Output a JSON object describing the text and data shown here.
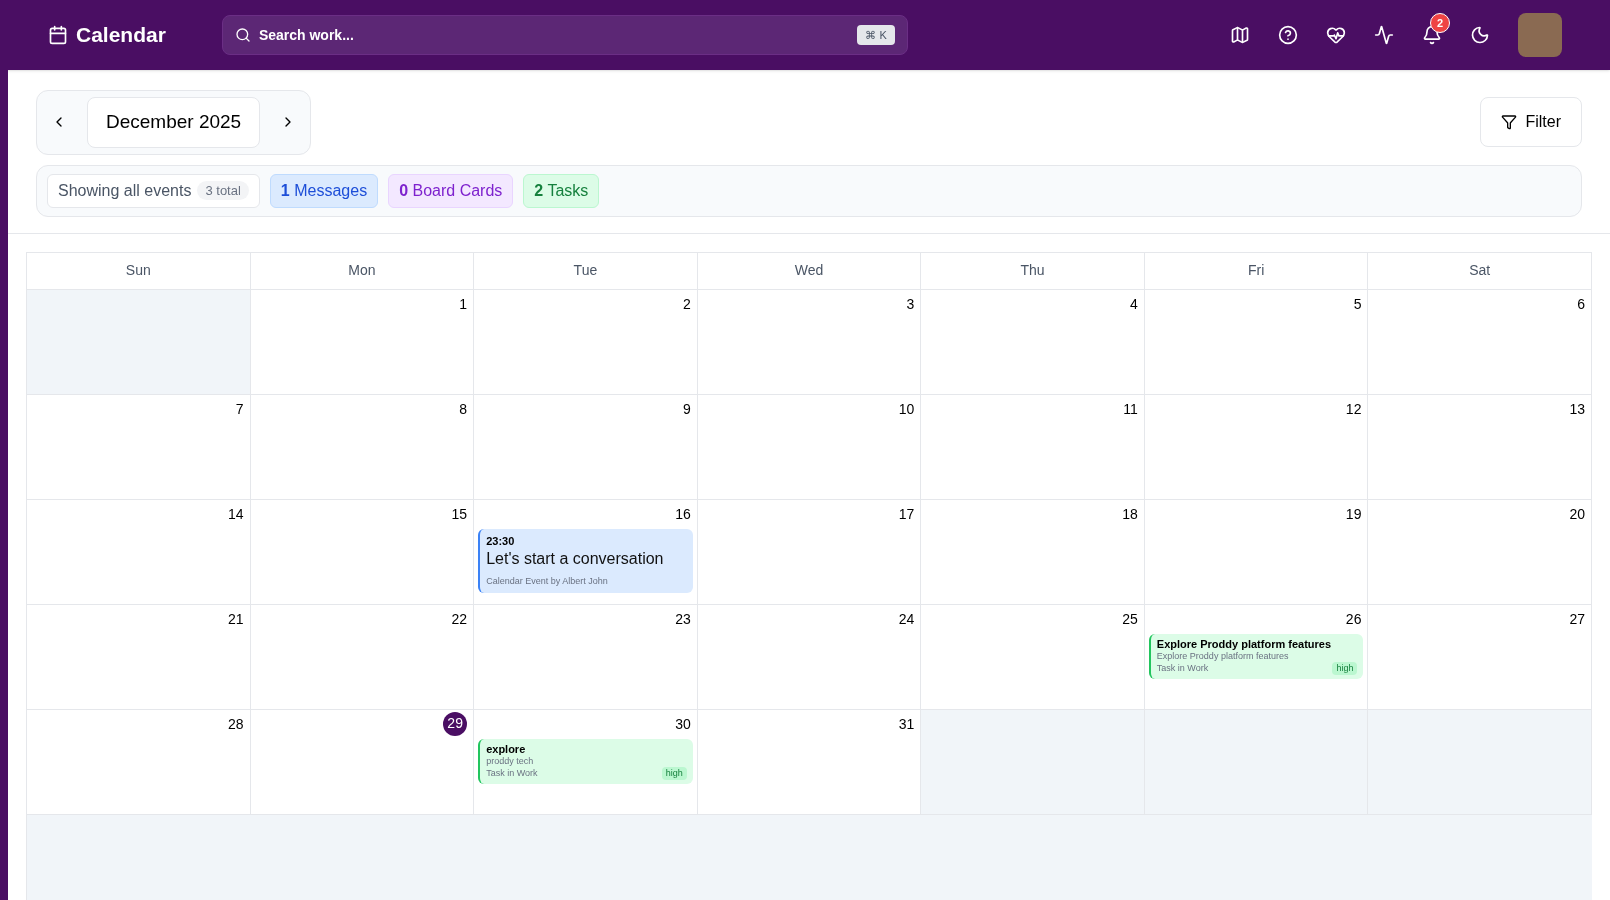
{
  "header": {
    "title": "Calendar",
    "search": {
      "placeholder": "Search work...",
      "shortcut": "⌘ K"
    },
    "notifications": "2"
  },
  "toolbar": {
    "month": "December 2025",
    "filter": "Filter"
  },
  "summary": {
    "label": "Showing all events",
    "total": "3 total",
    "chips": [
      {
        "count": "1",
        "label": "Messages",
        "kind": "messages"
      },
      {
        "count": "0",
        "label": "Board Cards",
        "kind": "cards"
      },
      {
        "count": "2",
        "label": "Tasks",
        "kind": "tasks"
      }
    ]
  },
  "weekdays": [
    "Sun",
    "Mon",
    "Tue",
    "Wed",
    "Thu",
    "Fri",
    "Sat"
  ],
  "weeks": [
    [
      {
        "outside": true
      },
      {
        "outside": false,
        "day": "1",
        "today": false
      },
      {
        "outside": false,
        "day": "2",
        "today": false
      },
      {
        "outside": false,
        "day": "3",
        "today": false
      },
      {
        "outside": false,
        "day": "4",
        "today": false
      },
      {
        "outside": false,
        "day": "5",
        "today": false
      },
      {
        "outside": false,
        "day": "6",
        "today": false
      }
    ],
    [
      {
        "outside": false,
        "day": "7",
        "today": false
      },
      {
        "outside": false,
        "day": "8",
        "today": false
      },
      {
        "outside": false,
        "day": "9",
        "today": false
      },
      {
        "outside": false,
        "day": "10",
        "today": false
      },
      {
        "outside": false,
        "day": "11",
        "today": false
      },
      {
        "outside": false,
        "day": "12",
        "today": false
      },
      {
        "outside": false,
        "day": "13",
        "today": false
      }
    ],
    [
      {
        "outside": false,
        "day": "14",
        "today": false
      },
      {
        "outside": false,
        "day": "15",
        "today": false
      },
      {
        "outside": false,
        "day": "16",
        "today": false,
        "events": [
          {
            "kind": "message",
            "time": "23:30",
            "title": "Let's start a conversation",
            "meta": "Calendar Event by Albert John"
          }
        ]
      },
      {
        "outside": false,
        "day": "17",
        "today": false
      },
      {
        "outside": false,
        "day": "18",
        "today": false
      },
      {
        "outside": false,
        "day": "19",
        "today": false
      },
      {
        "outside": false,
        "day": "20",
        "today": false
      }
    ],
    [
      {
        "outside": false,
        "day": "21",
        "today": false
      },
      {
        "outside": false,
        "day": "22",
        "today": false
      },
      {
        "outside": false,
        "day": "23",
        "today": false
      },
      {
        "outside": false,
        "day": "24",
        "today": false
      },
      {
        "outside": false,
        "day": "25",
        "today": false
      },
      {
        "outside": false,
        "day": "26",
        "today": false,
        "events": [
          {
            "kind": "task",
            "title": "Explore Proddy platform features",
            "subtitle": "Explore Proddy platform features",
            "meta": "Task in Work",
            "priority": "high"
          }
        ]
      },
      {
        "outside": false,
        "day": "27",
        "today": false
      }
    ],
    [
      {
        "outside": false,
        "day": "28",
        "today": false
      },
      {
        "outside": false,
        "day": "29",
        "today": true
      },
      {
        "outside": false,
        "day": "30",
        "today": false,
        "events": [
          {
            "kind": "task",
            "title": "explore",
            "subtitle": "proddy tech",
            "meta": "Task in Work",
            "priority": "high"
          }
        ]
      },
      {
        "outside": false,
        "day": "31",
        "today": false
      },
      {
        "outside": true
      },
      {
        "outside": true
      },
      {
        "outside": true
      }
    ]
  ]
}
